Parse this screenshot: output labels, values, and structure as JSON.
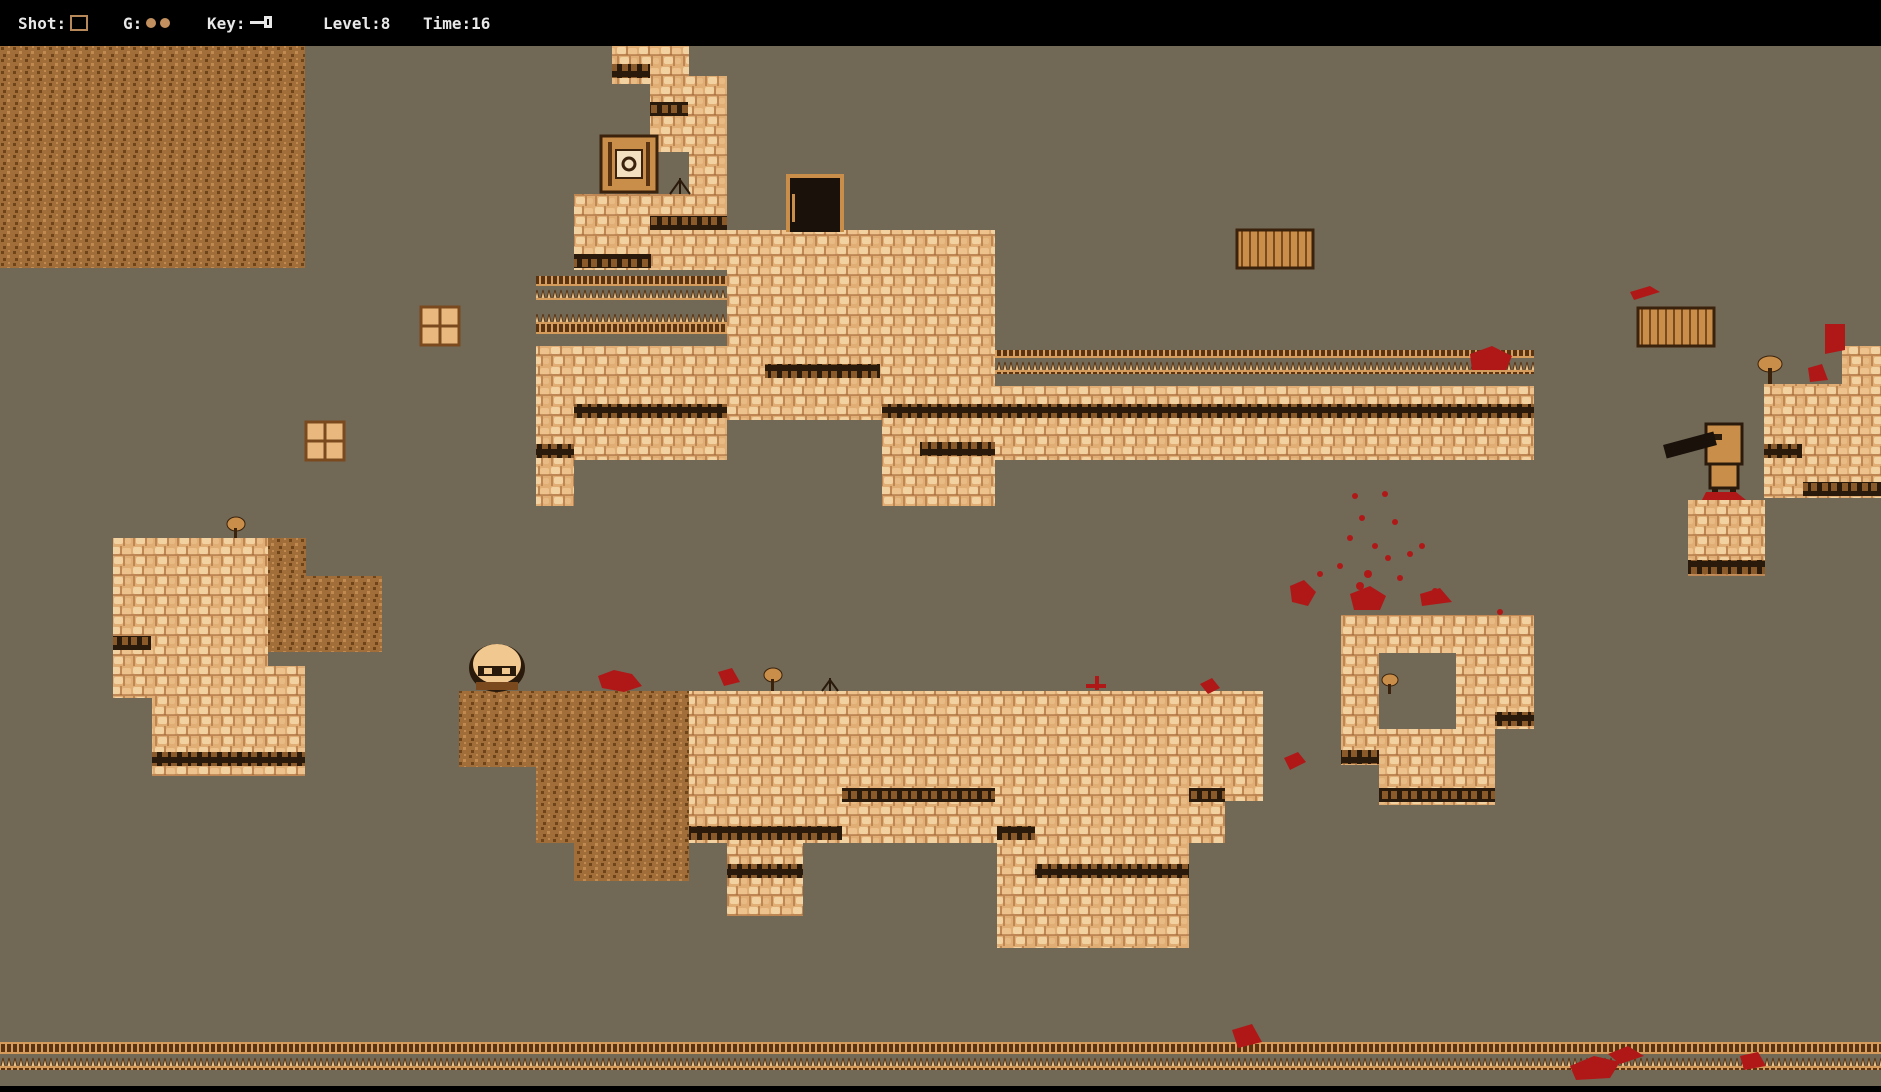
{
  "hud": {
    "shot_label": "Shot:",
    "gold_label": "G:",
    "gold_count": 2,
    "key_label": "Key:",
    "level_text": "Level:8",
    "time_text": "Time:16"
  },
  "colors": {
    "background": "#716856",
    "hud": "#000000",
    "rock": "#e4b37b",
    "rock_dark": "#7a4a1e",
    "dirt": "#9c6a36",
    "blood": "#b01818",
    "crate": "#c98f4a"
  },
  "icons": {
    "shot": "square-outline-icon",
    "gold": "coin-icon",
    "key": "key-icon"
  }
}
